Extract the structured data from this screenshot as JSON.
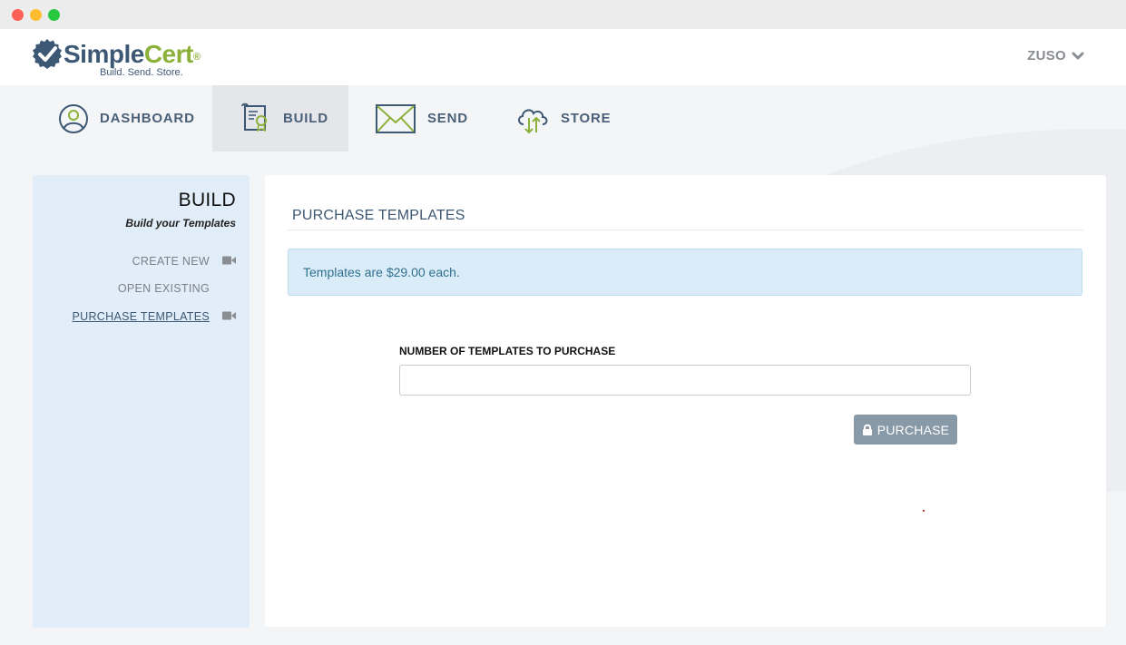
{
  "brand": {
    "name_part1": "Simple",
    "name_part2": "Cert",
    "registered": "®",
    "tagline": "Build. Send. Store.",
    "colors": {
      "navy": "#3d5874",
      "green": "#8cb13a"
    }
  },
  "header": {
    "user_name": "ZUSO",
    "user_chevron_icon": "chevron-down-icon"
  },
  "nav": {
    "items": [
      {
        "label": "DASHBOARD",
        "icon": "user-circle-icon"
      },
      {
        "label": "BUILD",
        "icon": "certificate-icon",
        "active": true
      },
      {
        "label": "SEND",
        "icon": "envelope-icon"
      },
      {
        "label": "STORE",
        "icon": "cloud-transfer-icon"
      }
    ]
  },
  "sidebar": {
    "title": "BUILD",
    "subtitle": "Build your Templates",
    "links": [
      {
        "label": "CREATE NEW",
        "video_icon": true
      },
      {
        "label": "OPEN EXISTING",
        "video_icon": false
      },
      {
        "label": "PURCHASE TEMPLATES",
        "video_icon": true,
        "current": true
      }
    ]
  },
  "main": {
    "title": "PURCHASE TEMPLATES",
    "info_message": "Templates are $29.00 each.",
    "quantity_label": "NUMBER OF TEMPLATES TO PURCHASE",
    "quantity_value": "",
    "quantity_placeholder": "",
    "purchase_label": "PURCHASE",
    "purchase_icon": "lock-icon"
  }
}
